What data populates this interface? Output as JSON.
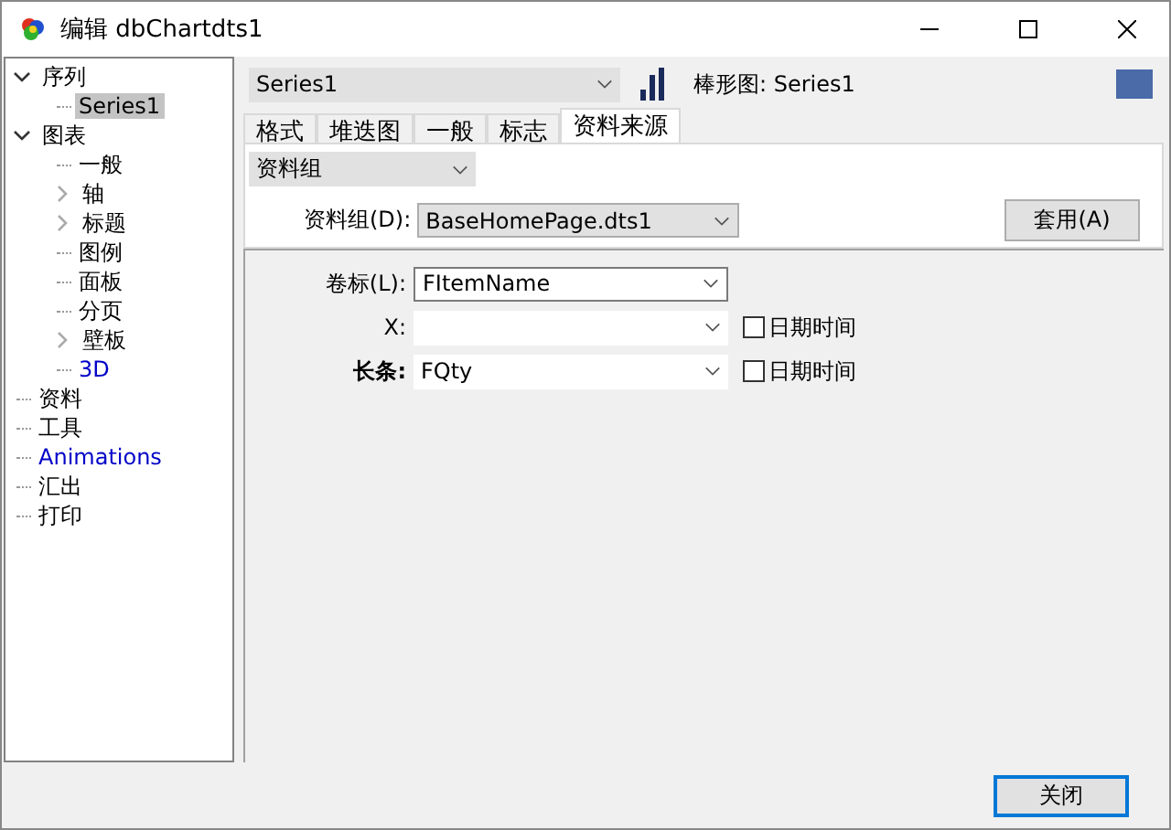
{
  "window": {
    "title": "编辑 dbChartdts1"
  },
  "tree": [
    {
      "label": "序列",
      "expanded": true,
      "selected": false,
      "color": "#000000",
      "children": [
        {
          "label": "Series1",
          "selected": true,
          "color": "#000000"
        }
      ]
    },
    {
      "label": "图表",
      "expanded": true,
      "selected": false,
      "color": "#000000",
      "children": [
        {
          "label": "一般",
          "selected": false,
          "color": "#000000"
        },
        {
          "label": "轴",
          "expanded": false,
          "selected": false,
          "color": "#000000"
        },
        {
          "label": "标题",
          "expanded": false,
          "selected": false,
          "color": "#000000"
        },
        {
          "label": "图例",
          "selected": false,
          "color": "#000000"
        },
        {
          "label": "面板",
          "selected": false,
          "color": "#000000"
        },
        {
          "label": "分页",
          "selected": false,
          "color": "#000000"
        },
        {
          "label": "壁板",
          "expanded": false,
          "selected": false,
          "color": "#000000"
        },
        {
          "label": "3D",
          "selected": false,
          "color": "#0000c8"
        }
      ]
    },
    {
      "label": "资料",
      "selected": false,
      "color": "#000000"
    },
    {
      "label": "工具",
      "selected": false,
      "color": "#000000"
    },
    {
      "label": "Animations",
      "selected": false,
      "color": "#0000c8"
    },
    {
      "label": "汇出",
      "selected": false,
      "color": "#000000"
    },
    {
      "label": "打印",
      "selected": false,
      "color": "#000000"
    }
  ],
  "series_select": {
    "value": "Series1"
  },
  "series_info": {
    "label": "棒形图: Series1",
    "color": "#4a6aa8"
  },
  "tabs": [
    {
      "label": "格式",
      "selected": false
    },
    {
      "label": "堆迭图",
      "selected": false
    },
    {
      "label": "一般",
      "selected": false
    },
    {
      "label": "标志",
      "selected": false
    },
    {
      "label": "资料来源",
      "selected": true
    }
  ],
  "source_select": {
    "value": "资料组"
  },
  "dataset": {
    "label": "资料组(D):",
    "value": "BaseHomePage.dts1",
    "apply_button": "套用(A)"
  },
  "fields": [
    {
      "label": "卷标(L):",
      "value": "FItemName",
      "kind": "boxed",
      "bold": false
    },
    {
      "label": "X:",
      "kind": "flat",
      "bold": false,
      "checkbox": {
        "label": "日期时间",
        "checked": false
      }
    },
    {
      "label": "长条:",
      "value": "FQty",
      "kind": "flat",
      "bold": true,
      "checkbox": {
        "label": "日期时间",
        "checked": false
      }
    }
  ],
  "close_button": "关闭"
}
